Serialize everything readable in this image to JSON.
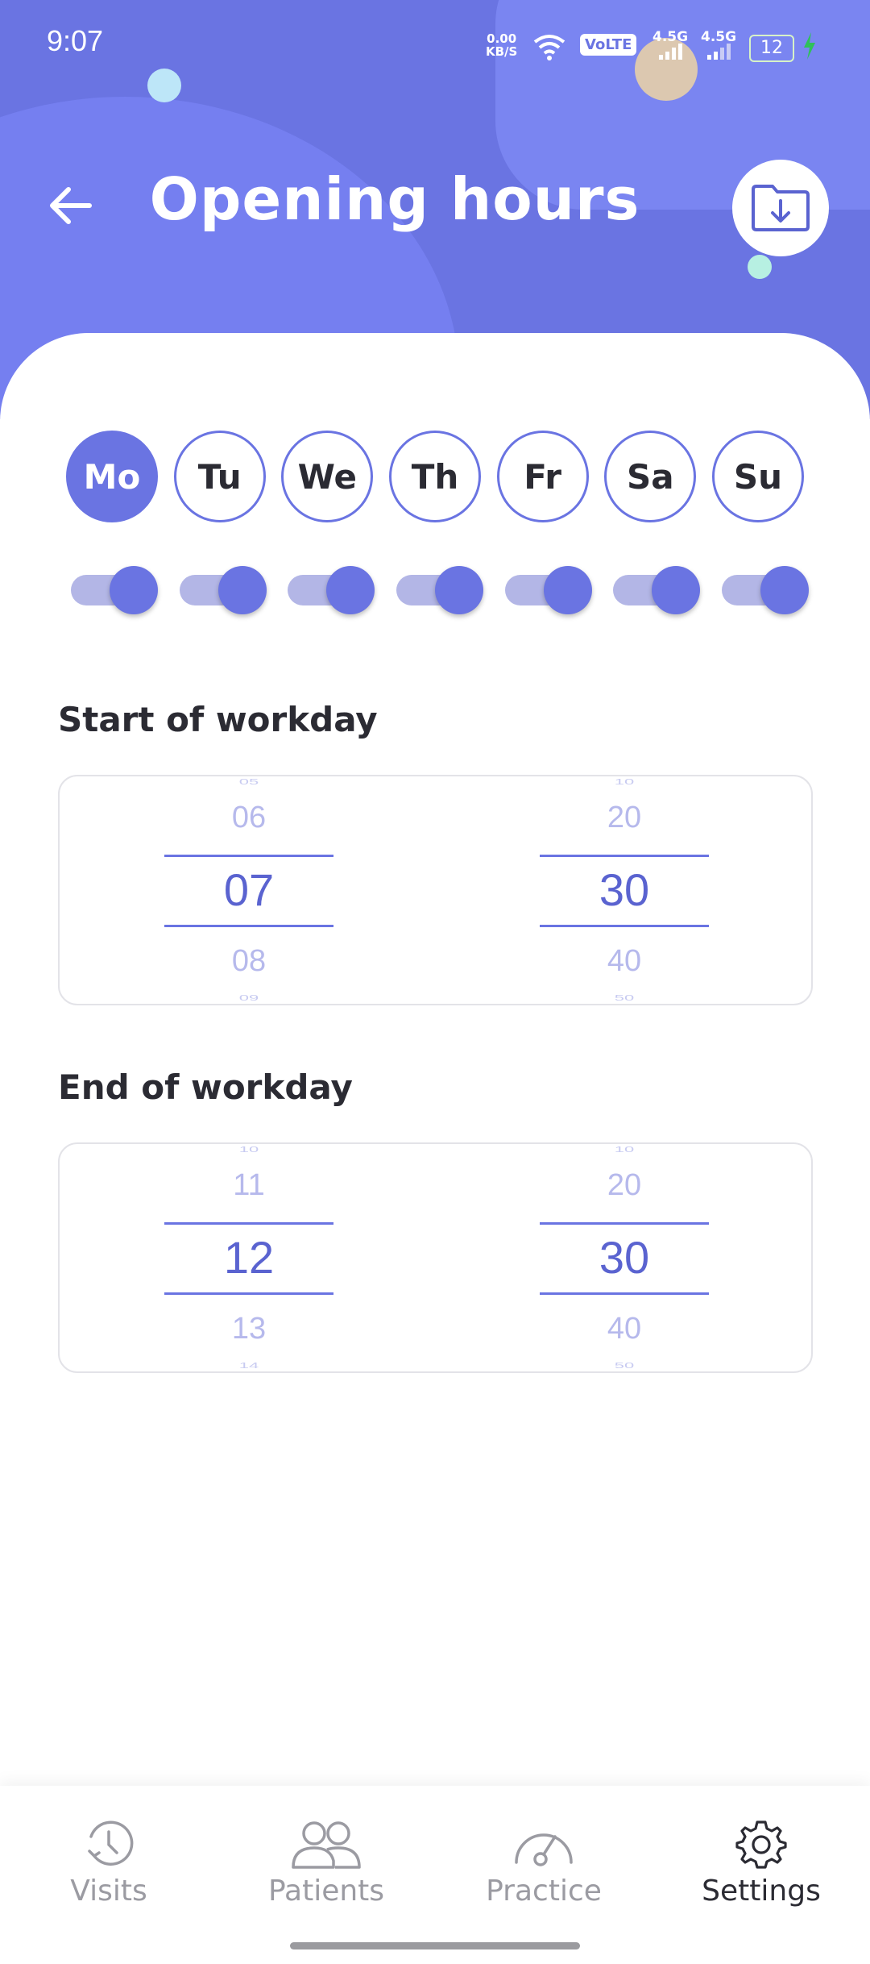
{
  "status_bar": {
    "time": "9:07",
    "net_speed_value": "0.00",
    "net_speed_unit": "KB/S",
    "volte": "VoLTE",
    "sim1_label": "4.5G",
    "sim2_label": "4.5G",
    "battery": "12"
  },
  "header": {
    "title": "Opening hours",
    "back_icon": "arrow-left-icon",
    "save_icon": "folder-download-icon"
  },
  "days": [
    {
      "label": "Mo",
      "selected": true,
      "enabled": true
    },
    {
      "label": "Tu",
      "selected": false,
      "enabled": true
    },
    {
      "label": "We",
      "selected": false,
      "enabled": true
    },
    {
      "label": "Th",
      "selected": false,
      "enabled": true
    },
    {
      "label": "Fr",
      "selected": false,
      "enabled": true
    },
    {
      "label": "Sa",
      "selected": false,
      "enabled": true
    },
    {
      "label": "Su",
      "selected": false,
      "enabled": true
    }
  ],
  "start": {
    "label": "Start of workday",
    "hours": {
      "above": "06",
      "selected": "07",
      "below": "08",
      "edge_top": "05",
      "edge_bottom": "09"
    },
    "minutes": {
      "above": "20",
      "selected": "30",
      "below": "40",
      "edge_top": "10",
      "edge_bottom": "50"
    }
  },
  "end": {
    "label": "End of workday",
    "hours": {
      "above": "11",
      "selected": "12",
      "below": "13",
      "edge_top": "10",
      "edge_bottom": "14"
    },
    "minutes": {
      "above": "20",
      "selected": "30",
      "below": "40",
      "edge_top": "10",
      "edge_bottom": "50"
    }
  },
  "tabs": [
    {
      "label": "Visits",
      "icon": "clock-history-icon",
      "active": false
    },
    {
      "label": "Patients",
      "icon": "people-icon",
      "active": false
    },
    {
      "label": "Practice",
      "icon": "gauge-icon",
      "active": false
    },
    {
      "label": "Settings",
      "icon": "gear-icon",
      "active": true
    }
  ],
  "colors": {
    "accent": "#6a74e2",
    "header_bg": "#6a74e2",
    "toggle_track": "#b3b6e6"
  }
}
